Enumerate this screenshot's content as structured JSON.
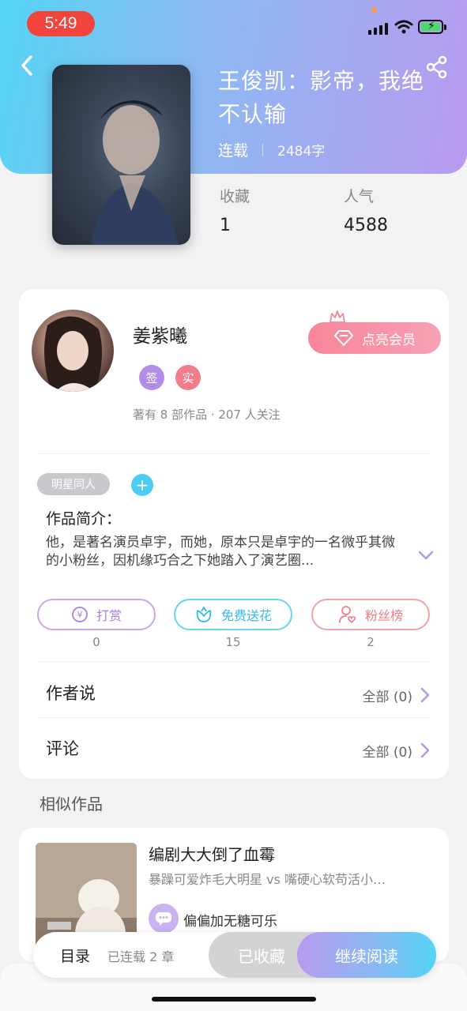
{
  "status_bar": {
    "time": "5:49"
  },
  "book": {
    "title": "王俊凯：影帝，我绝不认输",
    "status": "连载",
    "word_count": "2484字",
    "stats": [
      {
        "label": "收藏",
        "value": "1"
      },
      {
        "label": "人气",
        "value": "4588"
      }
    ]
  },
  "author": {
    "name": "姜紫曦",
    "badges": [
      "签",
      "实"
    ],
    "stats_text": "著有 8 部作品 · 207 人关注",
    "vip_button": "点亮会员"
  },
  "tags": [
    "明星同人"
  ],
  "add_tag_symbol": "+",
  "intro": {
    "label": "作品简介：",
    "text": "他，是著名演员卓宇，而她，原本只是卓宇的一名微乎其微的小粉丝，因机缘巧合之下她踏入了演艺圈..."
  },
  "actions": [
    {
      "label": "打赏",
      "count": "0",
      "color": "#a880e0"
    },
    {
      "label": "免费送花",
      "count": "15",
      "color": "#32bbe5"
    },
    {
      "label": "粉丝榜",
      "count": "2",
      "color": "#ec7f8a"
    }
  ],
  "sections": [
    {
      "title": "作者说",
      "value": "全部 (0)"
    },
    {
      "title": "评论",
      "value": "全部 (0)"
    }
  ],
  "similar": {
    "heading": "相似作品",
    "items": [
      {
        "title": "编剧大大倒了血霉",
        "desc": "暴躁可爱炸毛大明星 vs 嘴硬心软苟活小…",
        "author": "偏偏加无糖可乐"
      }
    ]
  },
  "bottom_bar": {
    "toc_label": "目录",
    "toc_status": "已连载 2 章",
    "collected_label": "已收藏",
    "continue_label": "继续阅读"
  },
  "colors": {
    "accent_gradient_start": "#55d4f5",
    "accent_gradient_end": "#b89af0",
    "vip_pink": "#f7859a"
  }
}
